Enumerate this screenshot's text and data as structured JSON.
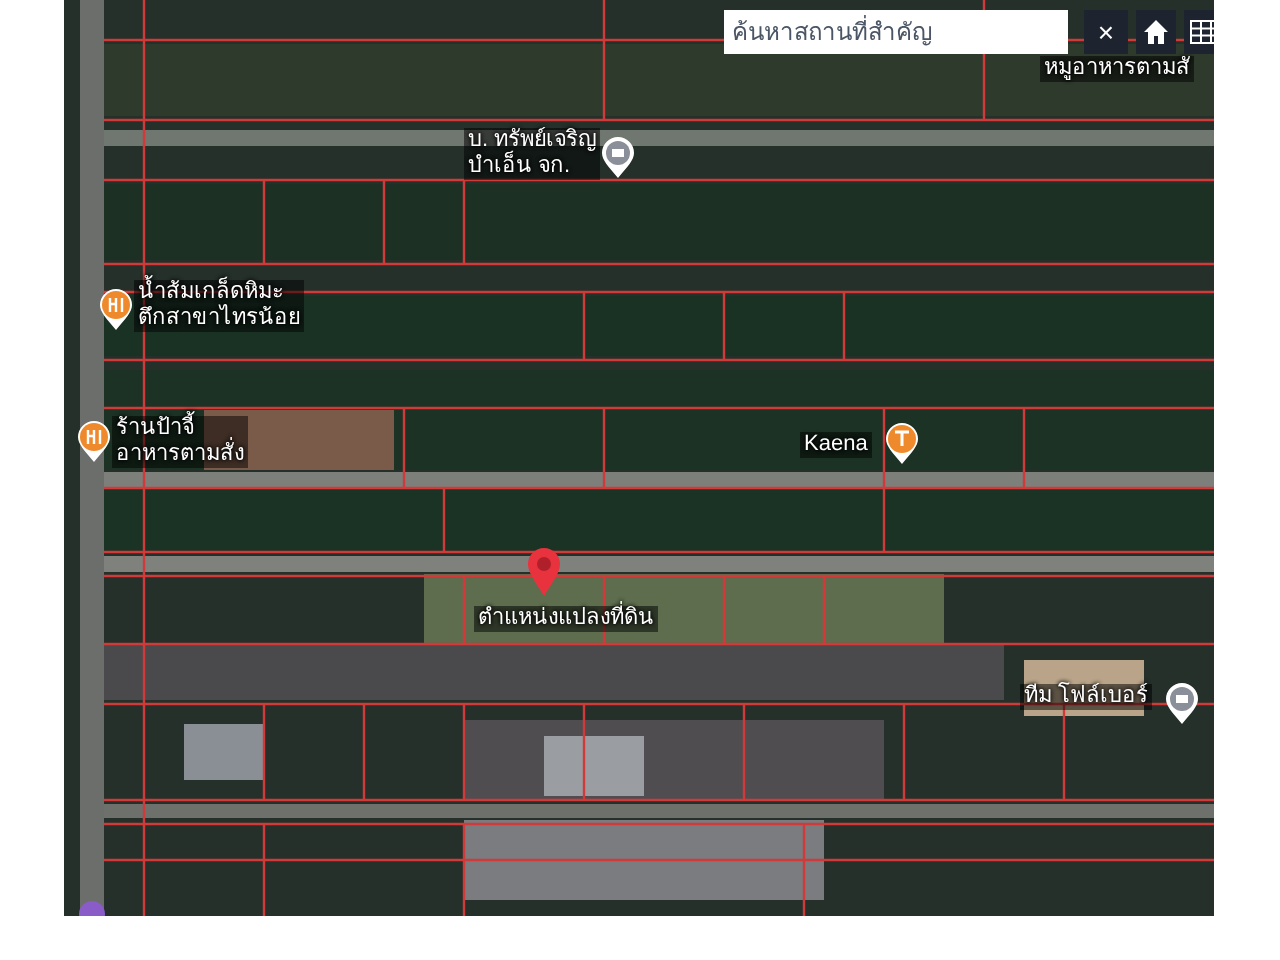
{
  "search": {
    "placeholder": "ค้นหาสถานที่สำคัญ"
  },
  "close_button": "×",
  "map_labels": [
    {
      "kind": "text",
      "lines": [
        "หมูอาหารตามสั"
      ]
    },
    {
      "kind": "place",
      "lines": [
        "บ. ทรัพย์เจริญ",
        "บำเอ็น จก."
      ]
    },
    {
      "kind": "food",
      "lines": [
        "น้ำส้มเกล็ดหิมะ",
        "ตึกสาขาไทรน้อย"
      ]
    },
    {
      "kind": "food",
      "lines": [
        "ร้านป้าจี้",
        "อาหารตามสั่ง"
      ]
    },
    {
      "kind": "shop",
      "lines": [
        "Kaena"
      ]
    },
    {
      "kind": "parcel",
      "lines": [
        "ตำแหน่งแปลงที่ดิน"
      ]
    },
    {
      "kind": "place",
      "lines": [
        "ทีม โฟล์เบอร์"
      ]
    }
  ]
}
